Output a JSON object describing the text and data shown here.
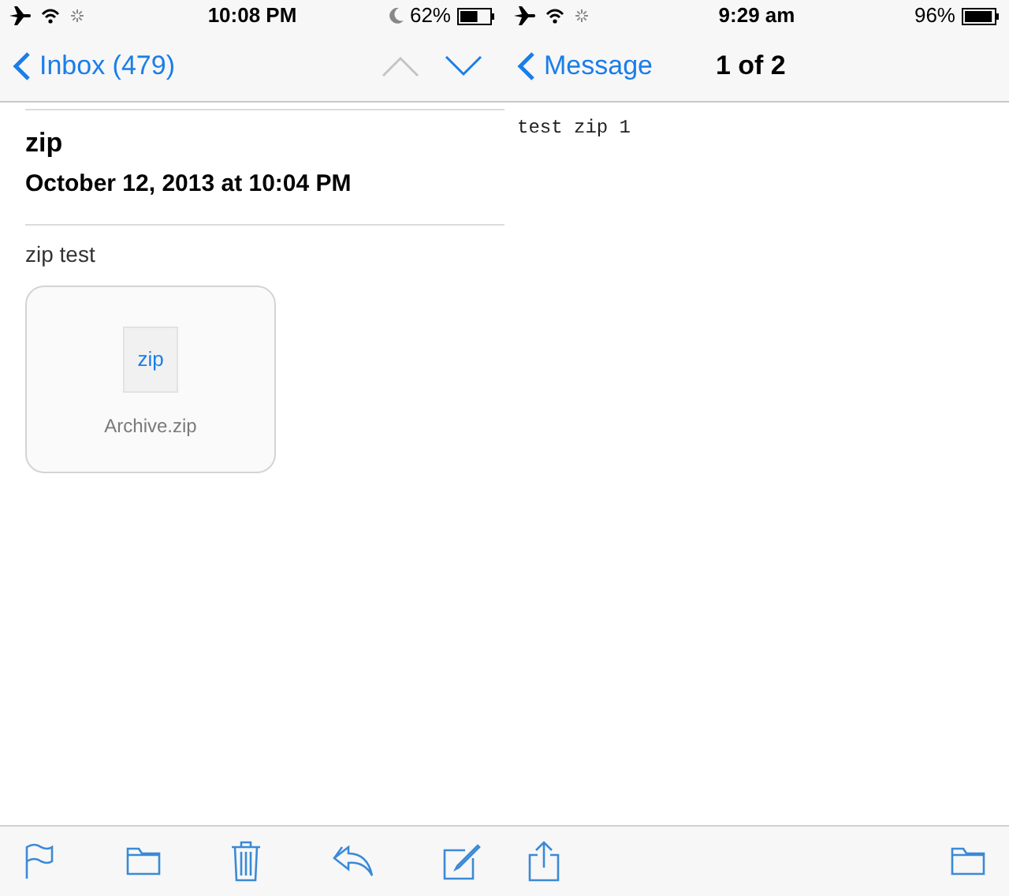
{
  "left": {
    "status_bar": {
      "time": "10:08 PM",
      "battery": "62%"
    },
    "nav": {
      "back": "Inbox (479)",
      "prev": {
        "disabled": true
      },
      "next": {
        "disabled": false
      }
    },
    "message": {
      "subject": "zip",
      "date": "October 12, 2013 at 10:04 PM",
      "body": "zip test",
      "attachment": {
        "type": "zip",
        "name": "Archive.zip"
      }
    }
  },
  "right": {
    "status_bar": {
      "time": "9:29 am",
      "battery": "96%"
    },
    "nav": {
      "back": "Message",
      "title": "1 of 2"
    },
    "body": "test zip 1"
  }
}
